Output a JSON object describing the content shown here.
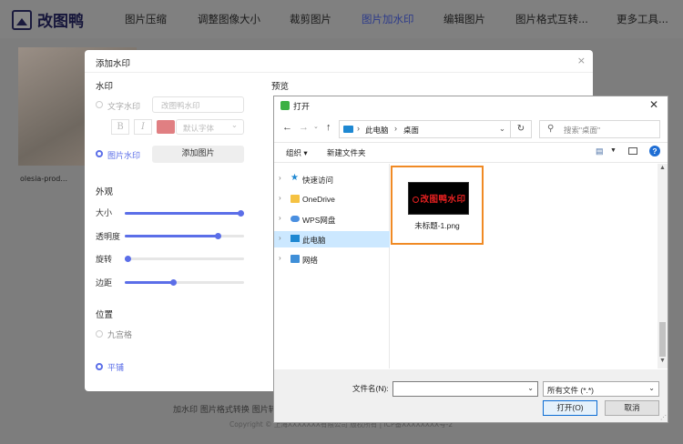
{
  "site": {
    "brand": "改图鸭",
    "nav": [
      "图片压缩",
      "调整图像大小",
      "裁剪图片",
      "图片加水印",
      "编辑图片",
      "图片格式互转...",
      "更多工具..."
    ],
    "active_nav": "图片加水印",
    "thumbnail_name": "olesia-prod...",
    "footer_links": "加水印  图片格式转换  图片转",
    "footer_copy": "Copyright © 上海XXXXXXX有限公司 版权所有 | ICP备XXXXXXXX号-2"
  },
  "watermark_dialog": {
    "title": "添加水印",
    "section_watermark": "水印",
    "text_option": "文字水印",
    "text_placeholder": "改图鸭水印",
    "bold": "B",
    "italic": "I",
    "font_value": "默认字体",
    "image_option": "图片水印",
    "add_image_button": "添加图片",
    "section_appearance": "外观",
    "sliders": [
      {
        "label": "大小",
        "value": 1.0
      },
      {
        "label": "透明度",
        "value": 0.8
      },
      {
        "label": "旋转",
        "value": 0.0
      },
      {
        "label": "边距",
        "value": 0.4
      }
    ],
    "section_position": "位置",
    "grid_option": "九宫格",
    "tile_option": "平铺",
    "section_preview": "预览",
    "accent_color": "#5b6ee8",
    "watermark_color": "#e07f82"
  },
  "file_dialog": {
    "title": "打开",
    "breadcrumb": [
      "此电脑",
      "桌面"
    ],
    "search_placeholder": "搜索\"桌面\"",
    "organize": "组织 ▾",
    "new_folder": "新建文件夹",
    "help": "?",
    "nav_items": [
      {
        "label": "快速访问",
        "icon": "star-icon"
      },
      {
        "label": "OneDrive",
        "icon": "folder-icon"
      },
      {
        "label": "WPS网盘",
        "icon": "cloud-icon"
      },
      {
        "label": "此电脑",
        "icon": "computer-icon",
        "selected": true
      },
      {
        "label": "网络",
        "icon": "network-icon"
      }
    ],
    "file": {
      "name": "未标题-1.png",
      "thumb_text": "改图鸭水印"
    },
    "filename_label": "文件名(N):",
    "filename_value": "",
    "filetype_value": "所有文件 (*.*)",
    "open_button": "打开(O)",
    "cancel_button": "取消",
    "highlight_color": "#f08a24"
  }
}
